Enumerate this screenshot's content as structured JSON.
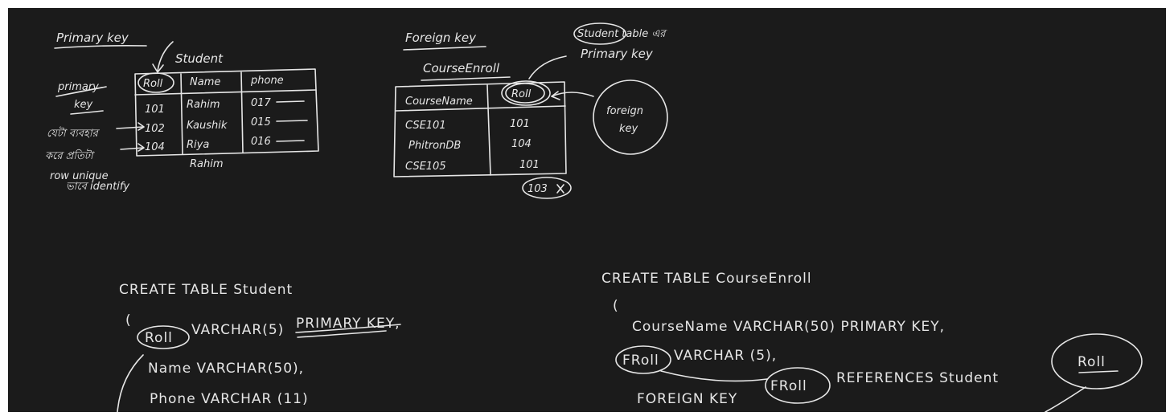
{
  "primary_key": {
    "title": "Primary key",
    "side_label": [
      "primary",
      "key"
    ],
    "table_name": "Student",
    "headers": [
      "Roll",
      "Name",
      "phone"
    ],
    "rows": [
      [
        "101",
        "Rahim",
        "017"
      ],
      [
        "102",
        "Kaushik",
        "015"
      ],
      [
        "104",
        "Riya",
        "016"
      ]
    ],
    "extra_name": "Rahim",
    "bangla_note": [
      "যেটা ব্যবহার",
      "করে প্রতিটা",
      "row unique",
      "ভাবে identify"
    ]
  },
  "foreign_key": {
    "title": "Foreign key",
    "table_name": "CourseEnroll",
    "headers": [
      "CourseName",
      "Roll"
    ],
    "rows": [
      [
        "CSE101",
        "101"
      ],
      [
        "PhitronDB",
        "104"
      ],
      [
        "CSE105",
        "101"
      ]
    ],
    "invalid_value": "103",
    "note": [
      "Student table এর",
      "Primary key"
    ],
    "circle_label": [
      "foreign",
      "key"
    ]
  },
  "sql_student": {
    "line1": "CREATE TABLE Student",
    "open": "(",
    "col1_name": "Roll",
    "col1_rest": "VARCHAR(5)",
    "col1_constraint": "PRIMARY KEY,",
    "col2": "Name VARCHAR(50),",
    "col3": "Phone VARCHAR (11)"
  },
  "sql_course": {
    "line1": "CREATE TABLE CourseEnroll",
    "open": "(",
    "col1": "CourseName VARCHAR(50) PRIMARY KEY,",
    "col2_name": "FRoll",
    "col2_rest": "VARCHAR (5),",
    "fk_keyword": "FOREIGN KEY",
    "fk_col": "FRoll",
    "references": "REFERENCES Student",
    "ref_col": "Roll"
  }
}
